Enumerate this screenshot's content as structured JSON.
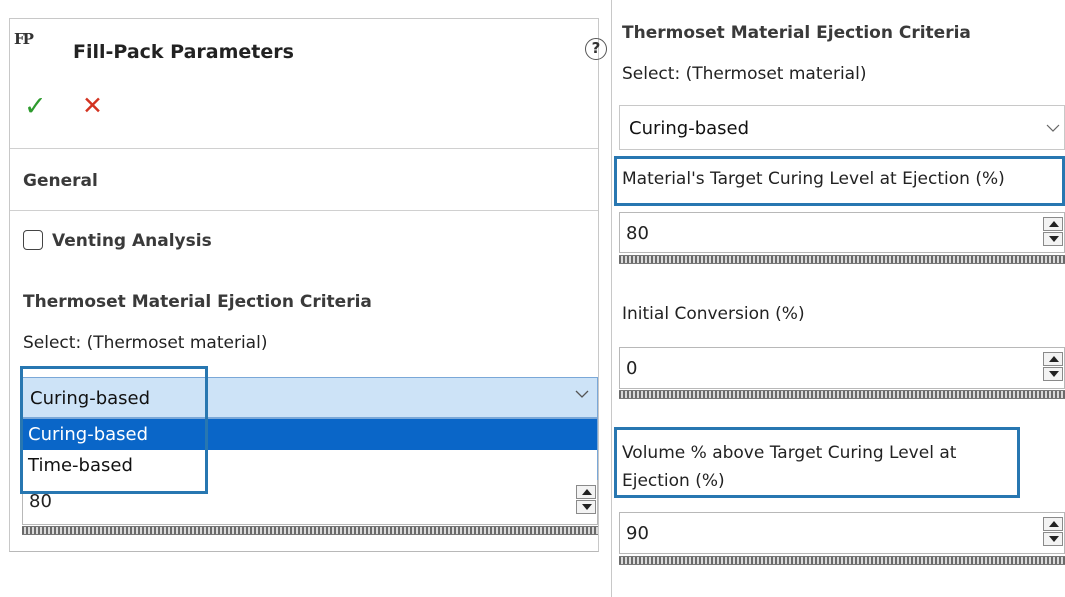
{
  "left": {
    "title": "Fill-Pack Parameters",
    "title_icon_glyph": "FP",
    "help_glyph": "?",
    "ok_glyph": "✓",
    "cancel_glyph": "✕",
    "general_label": "General",
    "venting_label": "Venting Analysis",
    "venting_checked": false,
    "ejection_heading": "Thermoset Material Ejection Criteria",
    "select_label": "Select: (Thermoset material)",
    "combo_value": "Curing-based",
    "dropdown_options": [
      "Curing-based",
      "Time-based"
    ],
    "dropdown_selected": "Curing-based",
    "partial_field_value": "80"
  },
  "right": {
    "ejection_heading": "Thermoset Material Ejection Criteria",
    "select_label": "Select: (Thermoset material)",
    "combo_value": "Curing-based",
    "target_curing_label": "Material's Target Curing Level at Ejection (%)",
    "target_curing_value": "80",
    "initial_conversion_label": "Initial Conversion (%)",
    "initial_conversion_value": "0",
    "volume_label_line1": "Volume % above Target Curing Level at",
    "volume_label_line2": "Ejection (%)",
    "volume_value": "90"
  },
  "colors": {
    "highlight": "#2877b1",
    "ok_green": "#2e9b2e",
    "cancel_red": "#d33321",
    "selection_blue": "#0a66c8",
    "combo_focus_bg": "#cde3f7"
  }
}
